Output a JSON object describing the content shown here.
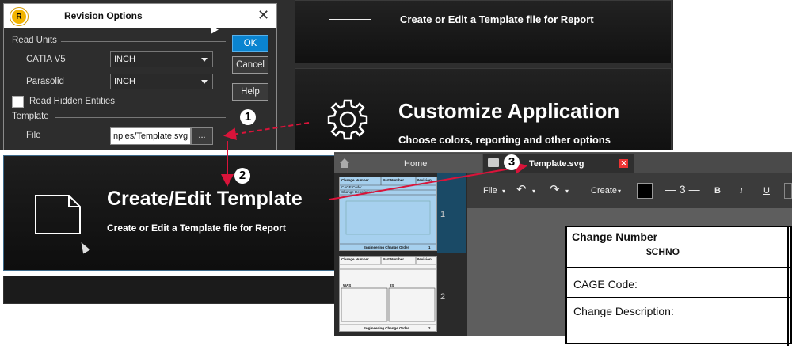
{
  "background": {
    "tile_top": {
      "subtitle": "Create or Edit a Template file for Report"
    },
    "tile_customize": {
      "title": "Customize Application",
      "subtitle": "Choose colors, reporting and other options"
    },
    "tile_create": {
      "title": "Create/Edit Template",
      "subtitle": "Create or Edit a Template file for Report"
    }
  },
  "dialog": {
    "title": "Revision Options",
    "logo_letter": "R",
    "close_glyph": "✕",
    "read_units": {
      "section_label": "Read Units",
      "catia": {
        "label": "CATIA V5",
        "value": "INCH"
      },
      "parasolid": {
        "label": "Parasolid",
        "value": "INCH"
      },
      "hidden_entities": {
        "label": "Read Hidden Entities",
        "checked": false
      }
    },
    "template": {
      "section_label": "Template",
      "file_label": "File",
      "file_value": "nples/Template.svg",
      "browse_label": "..."
    },
    "buttons": {
      "ok": "OK",
      "cancel": "Cancel",
      "help": "Help"
    }
  },
  "editor": {
    "tabs": {
      "home": "Home",
      "template": "Template.svg",
      "close_glyph": "✕"
    },
    "toolbar": {
      "file": "File",
      "create": "Create",
      "line_width": "3",
      "bold": "B",
      "italic": "I",
      "underline": "U"
    },
    "pages": [
      {
        "number": "1",
        "header": [
          "Change Number",
          "Part Number",
          "Revision"
        ],
        "footer": "Engineering Change Order",
        "footer_num": "1",
        "rows": [
          "CAGE Code:",
          "Change Description:"
        ]
      },
      {
        "number": "2",
        "header": [
          "Change Number",
          "Part Number",
          "Revision"
        ],
        "footer": "Engineering Change Order",
        "footer_num": "2",
        "labels": [
          "WAS",
          "IS"
        ]
      }
    ],
    "sheet": {
      "change_number_label": "Change Number",
      "change_number_value": "$CHNO",
      "cage_code": "CAGE Code:",
      "change_description": "Change Description:"
    }
  },
  "callouts": {
    "one": "1",
    "two": "2",
    "three": "3"
  },
  "colors": {
    "accent_blue": "#0a84d0",
    "arrow_red": "#d9143a",
    "selected_thumb": "#a6d0ee"
  }
}
